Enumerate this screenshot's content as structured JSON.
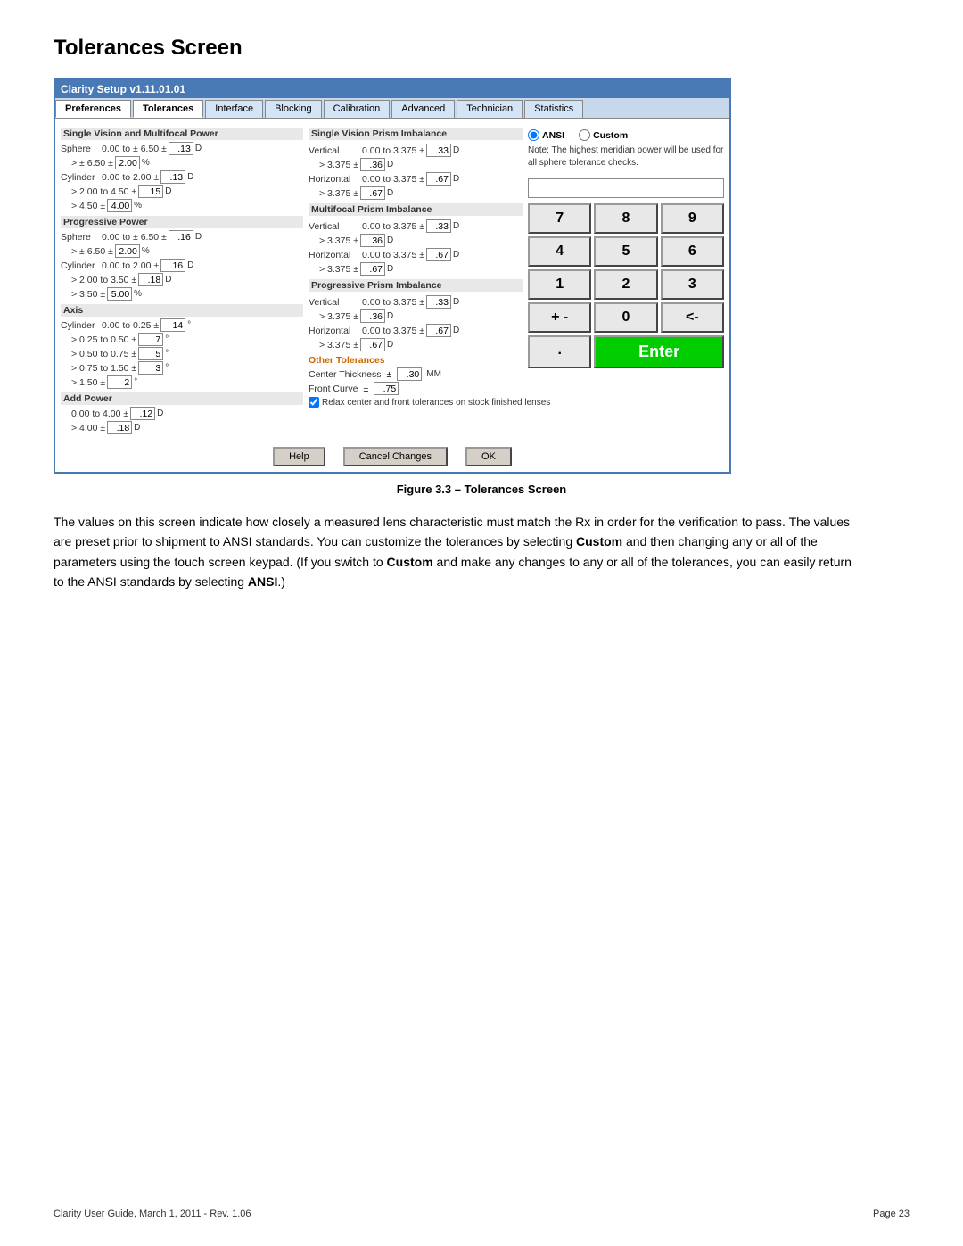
{
  "page": {
    "title": "Tolerances Screen",
    "figure_caption": "Figure 3.3 – Tolerances Screen",
    "footer_left": "Clarity User Guide, March 1, 2011 - Rev. 1.06",
    "footer_right": "Page 23"
  },
  "window": {
    "title": "Clarity Setup v1.11.01.01"
  },
  "tabs": [
    {
      "label": "Preferences",
      "active": false
    },
    {
      "label": "Tolerances",
      "active": true
    },
    {
      "label": "Interface",
      "active": false
    },
    {
      "label": "Blocking",
      "active": false
    },
    {
      "label": "Calibration",
      "active": false
    },
    {
      "label": "Advanced",
      "active": false
    },
    {
      "label": "Technician",
      "active": false
    },
    {
      "label": "Statistics",
      "active": false
    }
  ],
  "sv_multifocal": {
    "header": "Single Vision and Multifocal Power",
    "sphere_label": "Sphere",
    "sphere_row1": {
      "range": "0.00 to ± 6.50 ±",
      "val": ".13",
      "unit": "D"
    },
    "sphere_row2": {
      "range": "> ± 6.50 ±",
      "val": "2.00",
      "unit": "%"
    },
    "cylinder_label": "Cylinder",
    "cyl_row1": {
      "range": "0.00 to 2.00 ±",
      "val": ".13",
      "unit": "D"
    },
    "cyl_row2": {
      "range": "> 2.00 to 4.50 ±",
      "val": ".15",
      "unit": "D"
    },
    "cyl_row3": {
      "range": "> 4.50 ±",
      "val": "4.00",
      "unit": "%"
    }
  },
  "progressive_power": {
    "header": "Progressive Power",
    "sphere_label": "Sphere",
    "sphere_row1": {
      "range": "0.00 to ± 6.50 ±",
      "val": ".16",
      "unit": "D"
    },
    "sphere_row2": {
      "range": "> ± 6.50 ±",
      "val": "2.00",
      "unit": "%"
    },
    "cylinder_label": "Cylinder",
    "cyl_row1": {
      "range": "0.00 to 2.00 ±",
      "val": ".16",
      "unit": "D"
    },
    "cyl_row2": {
      "range": "> 2.00 to 3.50 ±",
      "val": ".18",
      "unit": "D"
    },
    "cyl_row3": {
      "range": "> 3.50 ±",
      "val": "5.00",
      "unit": "%"
    }
  },
  "axis": {
    "header": "Axis",
    "cylinder_label": "Cylinder",
    "row1": {
      "range": "0.00 to 0.25 ±",
      "val": "14",
      "unit": "°"
    },
    "row2": {
      "range": "> 0.25 to 0.50 ±",
      "val": "7",
      "unit": "°"
    },
    "row3": {
      "range": "> 0.50 to 0.75 ±",
      "val": "5",
      "unit": "°"
    },
    "row4": {
      "range": "> 0.75 to 1.50 ±",
      "val": "3",
      "unit": "°"
    },
    "row5": {
      "range": "> 1.50 ±",
      "val": "2",
      "unit": "°"
    }
  },
  "add_power": {
    "header": "Add Power",
    "row1": {
      "range": "0.00 to 4.00 ±",
      "val": ".12",
      "unit": "D"
    },
    "row2": {
      "range": "> 4.00 ±",
      "val": ".18",
      "unit": "D"
    }
  },
  "sv_prism": {
    "header": "Single Vision Prism Imbalance",
    "vertical_label": "Vertical",
    "v_row1": {
      "range": "0.00 to 3.375 ±",
      "val": ".33",
      "unit": "D"
    },
    "v_row2": {
      "range": "> 3.375 ±",
      "val": ".36",
      "unit": "D"
    },
    "horizontal_label": "Horizontal",
    "h_row1": {
      "range": "0.00 to 3.375 ±",
      "val": ".67",
      "unit": "D"
    },
    "h_row2": {
      "range": "> 3.375 ±",
      "val": ".67",
      "unit": "D"
    }
  },
  "mf_prism": {
    "header": "Multifocal Prism Imbalance",
    "vertical_label": "Vertical",
    "v_row1": {
      "range": "0.00 to 3.375 ±",
      "val": ".33",
      "unit": "D"
    },
    "v_row2": {
      "range": "> 3.375 ±",
      "val": ".36",
      "unit": "D"
    },
    "horizontal_label": "Horizontal",
    "h_row1": {
      "range": "0.00 to 3.375 ±",
      "val": ".67",
      "unit": "D"
    },
    "h_row2": {
      "range": "> 3.375 ±",
      "val": ".67",
      "unit": "D"
    }
  },
  "prog_prism": {
    "header": "Progressive Prism Imbalance",
    "vertical_label": "Vertical",
    "v_row1": {
      "range": "0.00 to 3.375 ±",
      "val": ".33",
      "unit": "D"
    },
    "v_row2": {
      "range": "> 3.375 ±",
      "val": ".36",
      "unit": "D"
    },
    "horizontal_label": "Horizontal",
    "h_row1": {
      "range": "0.00 to 3.375 ±",
      "val": ".67",
      "unit": "D"
    },
    "h_row2": {
      "range": "> 3.375 ±",
      "val": ".67",
      "unit": "D"
    }
  },
  "other_tolerances": {
    "header": "Other Tolerances",
    "center_thickness_label": "Center Thickness",
    "center_thickness_val": ".30",
    "center_thickness_unit": "MM",
    "front_curve_label": "Front Curve",
    "front_curve_val": ".75",
    "relax_label": "Relax center and front tolerances on stock finished lenses",
    "relax_checked": true
  },
  "ansi_custom": {
    "ansi_label": "ANSI",
    "custom_label": "Custom",
    "ansi_selected": true,
    "note": "Note: The highest meridian power will be used for all sphere tolerance checks."
  },
  "numpad": {
    "display": "",
    "keys": [
      "7",
      "8",
      "9",
      "4",
      "5",
      "6",
      "1",
      "2",
      "3",
      "+ -",
      "0",
      "<-"
    ],
    "enter": "Enter",
    "dot": "."
  },
  "buttons": {
    "help": "Help",
    "cancel": "Cancel Changes",
    "ok": "OK"
  },
  "body_text": "The values on this screen indicate how closely a measured lens characteristic must match the Rx in order for the verification to pass.  The values are preset prior to shipment to ANSI standards.  You can customize the tolerances by selecting Custom and then changing any or all of the parameters using the touch screen keypad.  (If you switch to Custom and make any changes to any or all of the tolerances, you can easily return to the ANSI standards by selecting ANSI.)"
}
